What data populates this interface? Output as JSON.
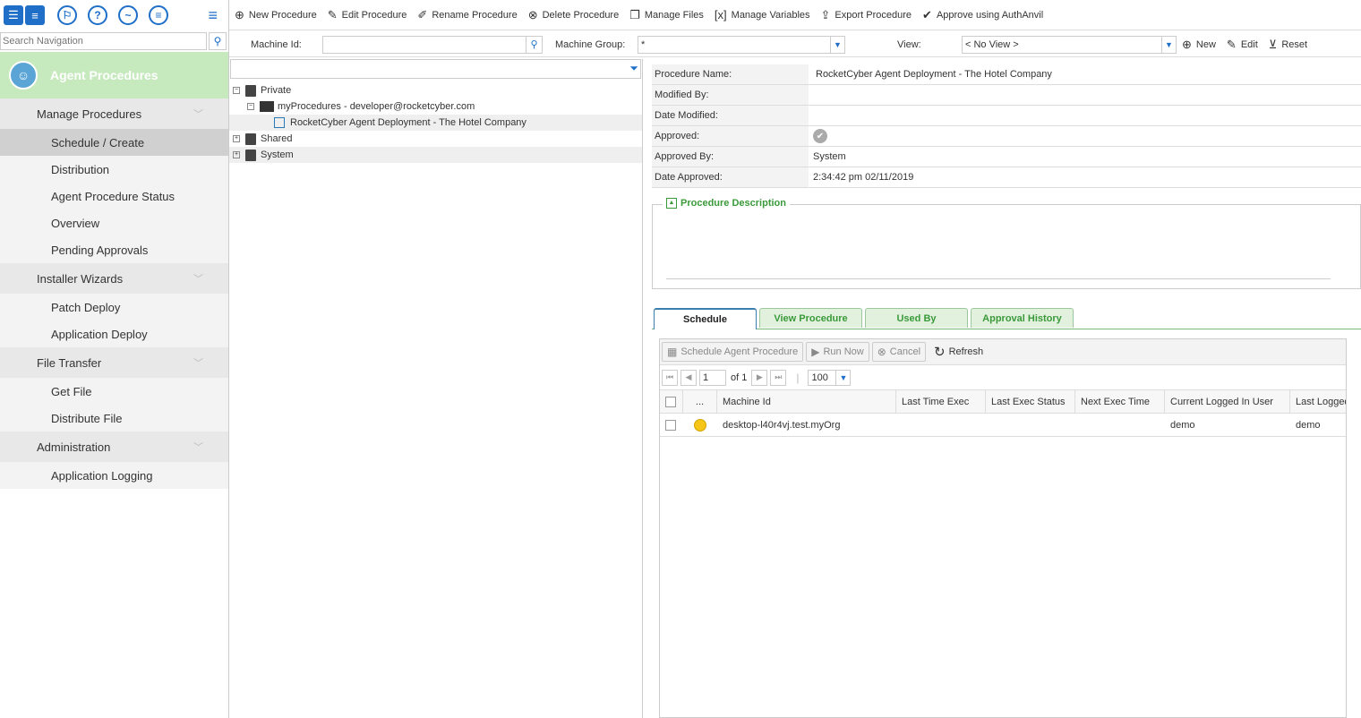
{
  "nav": {
    "search_placeholder": "Search Navigation",
    "module_title": "Agent Procedures",
    "sections": [
      {
        "label": "Manage Procedures",
        "items": [
          "Schedule / Create",
          "Distribution",
          "Agent Procedure Status",
          "Overview",
          "Pending Approvals"
        ]
      },
      {
        "label": "Installer Wizards",
        "items": [
          "Patch Deploy",
          "Application Deploy"
        ]
      },
      {
        "label": "File Transfer",
        "items": [
          "Get File",
          "Distribute File"
        ]
      },
      {
        "label": "Administration",
        "items": [
          "Application Logging"
        ]
      }
    ],
    "active_item": "Schedule / Create"
  },
  "toolbar": {
    "new_procedure": "New Procedure",
    "edit_procedure": "Edit Procedure",
    "rename_procedure": "Rename Procedure",
    "delete_procedure": "Delete Procedure",
    "manage_files": "Manage Files",
    "manage_variables": "Manage Variables",
    "export_procedure": "Export Procedure",
    "approve": "Approve using AuthAnvil"
  },
  "filter": {
    "machine_id_label": "Machine Id:",
    "machine_id_value": "",
    "machine_group_label": "Machine Group:",
    "machine_group_value": "*",
    "view_label": "View:",
    "view_value": "< No View >",
    "new_label": "New",
    "edit_label": "Edit",
    "reset_label": "Reset"
  },
  "tree": {
    "private": "Private",
    "my_procedures": "myProcedures - developer@rocketcyber.com",
    "procedure": "RocketCyber Agent Deployment - The Hotel Company",
    "shared": "Shared",
    "system": "System"
  },
  "detail": {
    "procedure_name_label": "Procedure Name:",
    "procedure_name": "RocketCyber Agent Deployment - The Hotel Company",
    "modified_by_label": "Modified By:",
    "modified_by": "",
    "date_modified_label": "Date Modified:",
    "date_modified": "",
    "approved_label": "Approved:",
    "approved_by_label": "Approved By:",
    "approved_by": "System",
    "date_approved_label": "Date Approved:",
    "date_approved": "2:34:42 pm 02/11/2019",
    "description_label": "Procedure Description"
  },
  "tabs": [
    "Schedule",
    "View Procedure",
    "Used By",
    "Approval History"
  ],
  "schedule": {
    "schedule_btn": "Schedule Agent Procedure",
    "run_now_btn": "Run Now",
    "cancel_btn": "Cancel",
    "refresh_btn": "Refresh",
    "page_value": "1",
    "page_of": "of 1",
    "page_size": "100",
    "columns": [
      "...",
      "Machine Id",
      "Last Time Exec",
      "Last Exec Status",
      "Next Exec Time",
      "Current Logged In User",
      "Last Logged"
    ],
    "rows": [
      {
        "machine_id": "desktop-l40r4vj.test.myOrg",
        "last_time_exec": "",
        "last_exec_status": "",
        "next_exec_time": "",
        "current_user": "demo",
        "last_logged": "demo"
      }
    ]
  }
}
